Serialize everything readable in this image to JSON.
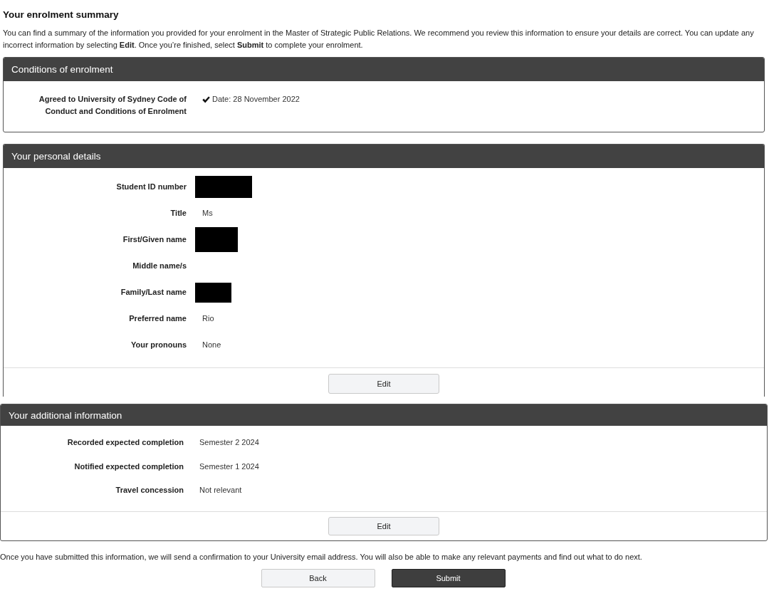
{
  "heading": "Your enrolment summary",
  "intro": "You can find a summary of the information you provided for your enrolment in the Master of Strategic Public Relations. We recommend you review this information to ensure your details are correct. You can update any incorrect information by selecting **Edit**. Once you’re finished, select **Submit** to complete your enrolment.",
  "sections": [
    {
      "title": "Conditions of enrolment",
      "fields": [
        {
          "label": "Agreed to University of Sydney Code of Conduct and Conditions of Enrolment",
          "kind": "confirmed",
          "value": "Date: 28 November 2022"
        }
      ]
    },
    {
      "title": "Your personal details",
      "fields": [
        {
          "label": "Student ID number",
          "kind": "redacted"
        },
        {
          "label": "Title",
          "kind": "text",
          "value": "Ms"
        },
        {
          "label": "First/Given name",
          "kind": "redacted"
        },
        {
          "label": "Middle name/s",
          "kind": "text"
        },
        {
          "label": "Family/Last name",
          "kind": "redacted"
        },
        {
          "label": "Preferred name",
          "kind": "text",
          "value": "Rio"
        },
        {
          "label": "Your pronouns",
          "kind": "text",
          "value": "None"
        }
      ],
      "edit_button": "Edit"
    },
    {
      "title": "Your additional information",
      "fields": [
        {
          "label": "Recorded expected completion",
          "kind": "text",
          "value": "Semester 2 2024"
        },
        {
          "label": "Notified expected completion",
          "kind": "text",
          "value": "Semester 1 2024"
        },
        {
          "label": "Travel concession",
          "kind": "text",
          "value": "Not relevant"
        }
      ],
      "edit_button": "Edit"
    }
  ],
  "footer_note": "Once you have submitted this information, we will send a confirmation to your University email address. You will also be able to make any relevant payments and find out what to do next.",
  "buttons": [
    {
      "label": "Back",
      "kind": "secondary"
    },
    {
      "label": "Submit",
      "kind": "primary"
    }
  ]
}
